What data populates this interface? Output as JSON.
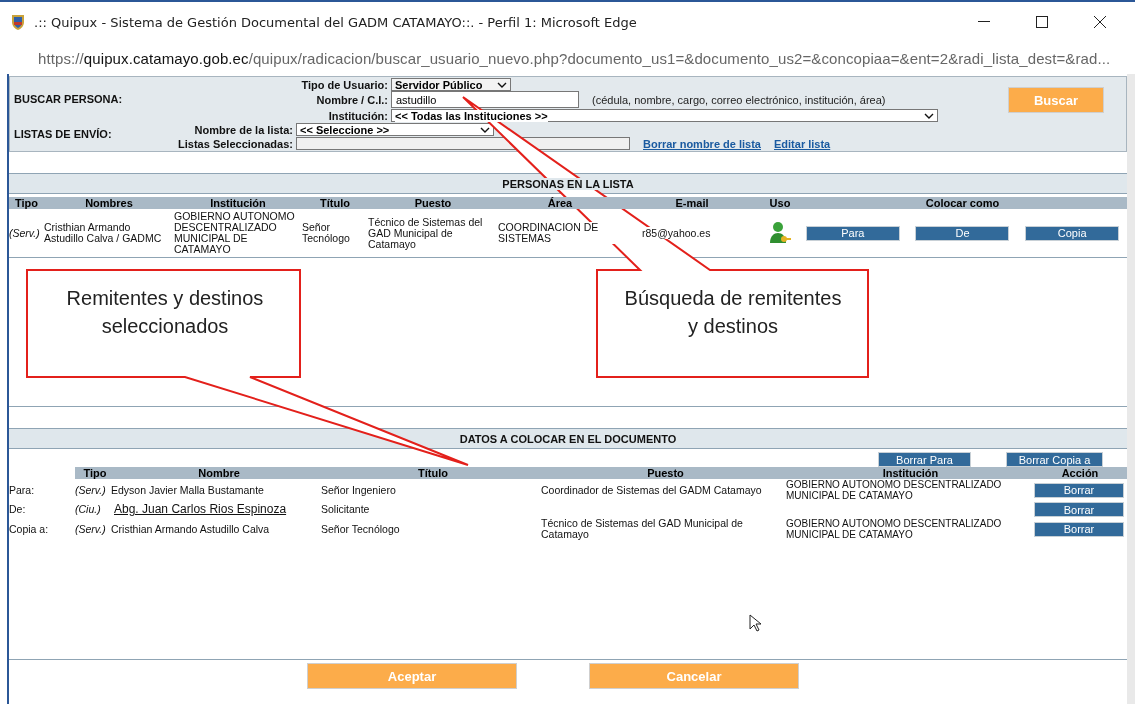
{
  "window": {
    "title": ".:: Quipux - Sistema de Gestión Documental del GADM CATAMAYO::. - Perfil 1: Microsoft Edge"
  },
  "address_bar": {
    "url_prefix": "https://",
    "url_host": "quipux.catamayo.gob.ec",
    "url_path": "/quipux/radicacion/buscar_usuario_nuevo.php?documento_us1=&documento_us2=&concopiaa=&ent=2&radi_lista_dest=&rad..."
  },
  "search": {
    "section_label": "BUSCAR PERSONA:",
    "lists_label": "LISTAS DE ENVÍO:",
    "user_type": {
      "label": "Tipo de Usuario:",
      "value": "Servidor Público"
    },
    "name": {
      "label": "Nombre / C.I.:",
      "value": "astudillo",
      "hint": "(cédula, nombre, cargo, correo electrónico, institución, área)"
    },
    "institution": {
      "label": "Institución:",
      "value": "<< Todas las Instituciones >>"
    },
    "list_name": {
      "label": "Nombre de la lista:",
      "value": "<< Seleccione >>"
    },
    "selected_lists": {
      "label": "Listas Seleccionadas:"
    },
    "links": [
      "Borrar nombre de lista",
      "Editar lista"
    ],
    "button": "Buscar"
  },
  "people": {
    "title": "PERSONAS EN LA LISTA",
    "columns": [
      "Tipo",
      "Nombres",
      "Institución",
      "Título",
      "Puesto",
      "Área",
      "E-mail",
      "Uso",
      "Colocar como"
    ],
    "rows": [
      {
        "tipo": "(Serv.)",
        "nombres": "Cristhian Armando Astudillo Calva / GADMC",
        "institucion": "GOBIERNO AUTONOMO DESCENTRALIZADO MUNICIPAL DE CATAMAYO",
        "titulo": "Señor Tecnólogo",
        "puesto": "Técnico de Sistemas del GAD Municipal de Catamayo",
        "area": "COORDINACION DE SISTEMAS",
        "email": "r85@yahoo.es",
        "actions": [
          "Para",
          "De",
          "Copia"
        ]
      }
    ]
  },
  "document": {
    "title": "DATOS A COLOCAR EN EL DOCUMENTO",
    "top_buttons": [
      "Borrar Para",
      "Borrar Copia a"
    ],
    "columns": [
      "Tipo",
      "Nombre",
      "Título",
      "Puesto",
      "Institución",
      "Acción"
    ],
    "rows": [
      {
        "role": "Para:",
        "tipo": "(Serv.)",
        "nombre": "Edyson Javier Malla Bustamante",
        "linked": false,
        "titulo": "Señor Ingeniero",
        "puesto": "Coordinador de Sistemas del GADM Catamayo",
        "institucion": "GOBIERNO AUTONOMO DESCENTRALIZADO MUNICIPAL DE CATAMAYO",
        "action": "Borrar"
      },
      {
        "role": "De:",
        "tipo": "(Ciu.)",
        "nombre": "Abg. Juan Carlos Rios Espinoza",
        "linked": true,
        "titulo": "Solicitante",
        "puesto": "",
        "institucion": "",
        "action": "Borrar"
      },
      {
        "role": "Copia a:",
        "tipo": "(Serv.)",
        "nombre": "Cristhian Armando Astudillo Calva",
        "linked": false,
        "titulo": "Señor Tecnólogo",
        "puesto": "Técnico de Sistemas del GAD Municipal de Catamayo",
        "institucion": "GOBIERNO AUTONOMO DESCENTRALIZADO MUNICIPAL DE CATAMAYO",
        "action": "Borrar"
      }
    ]
  },
  "footer_buttons": [
    "Aceptar",
    "Cancelar"
  ],
  "callouts": [
    {
      "text": "Remitentes y destinos seleccionados"
    },
    {
      "text": "Búsqueda de remitentes y destinos"
    }
  ]
}
